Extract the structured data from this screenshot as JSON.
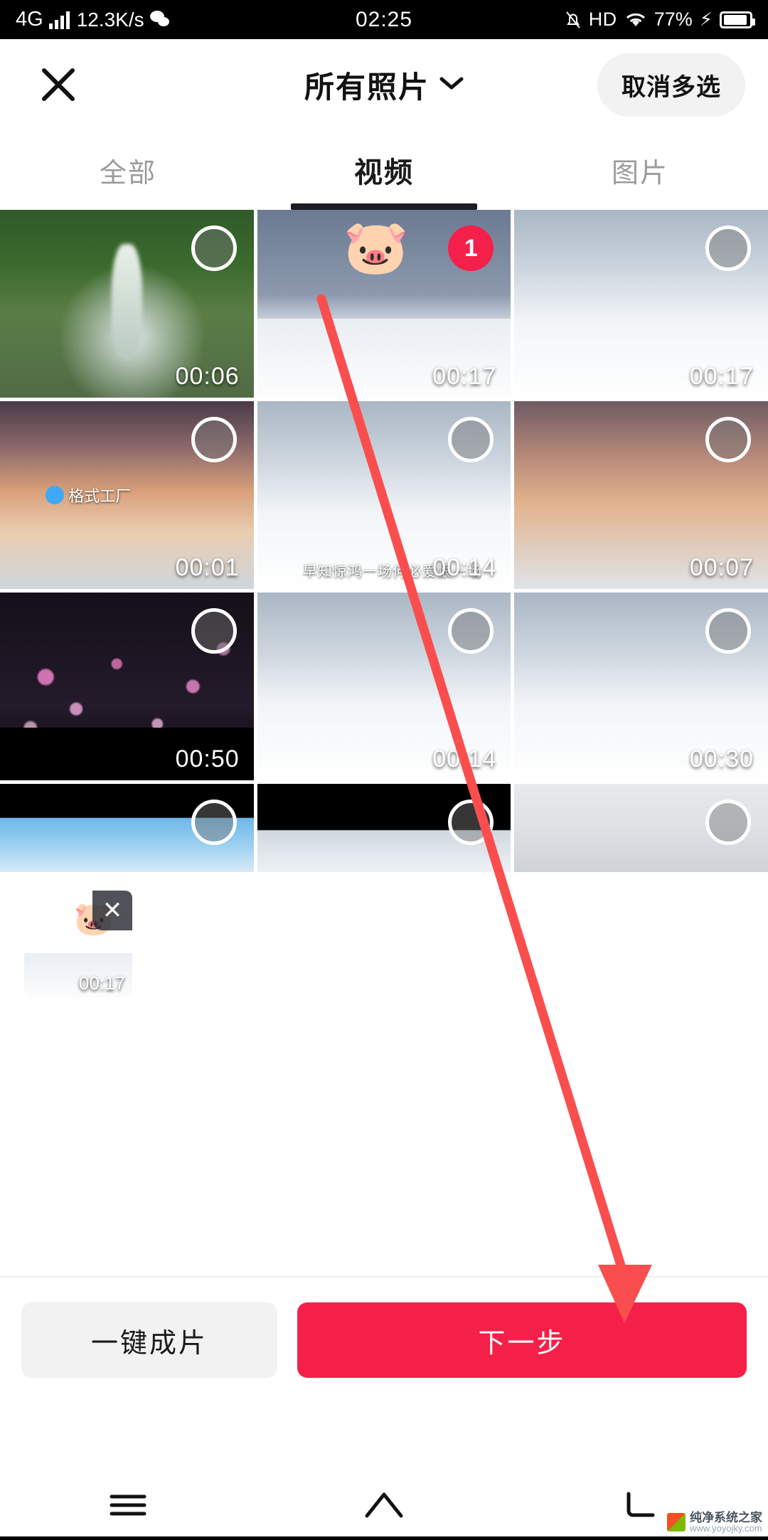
{
  "status_bar": {
    "network_type": "4G",
    "speed": "12.3K/s",
    "app_icon": "wechat-icon",
    "time": "02:25",
    "mute_icon": "bell-off-icon",
    "hd": "HD",
    "wifi_icon": "wifi-icon",
    "battery_percent": "77%",
    "charging_icon": "bolt-icon"
  },
  "header": {
    "close_icon": "close-icon",
    "title": "所有照片",
    "chevron_icon": "chevron-down-icon",
    "cancel_multi_label": "取消多选"
  },
  "tabs": [
    {
      "label": "全部",
      "active": false
    },
    {
      "label": "视频",
      "active": true
    },
    {
      "label": "图片",
      "active": false
    }
  ],
  "grid": {
    "rows": [
      [
        {
          "duration": "00:06",
          "selected": false,
          "scene": "sc-waterfall"
        },
        {
          "duration": "00:17",
          "selected": true,
          "badge": "1",
          "sticker": "🐷",
          "scene": "sc-snowdusk"
        },
        {
          "duration": "00:17",
          "selected": false,
          "scene": "sc-snowfence"
        }
      ],
      [
        {
          "duration": "00:01",
          "selected": false,
          "scene": "sc-sunset",
          "watermark": "格式工厂"
        },
        {
          "duration": "00:14",
          "selected": false,
          "scene": "sc-snowfence",
          "caption": "早知惊鸿一场何必爱恨一场"
        },
        {
          "duration": "00:07",
          "selected": false,
          "scene": "sc-sunset2"
        }
      ],
      [
        {
          "duration": "00:50",
          "selected": false,
          "scene": "sc-blossom"
        },
        {
          "duration": "00:14",
          "selected": false,
          "scene": "sc-snowfence"
        },
        {
          "duration": "00:30",
          "selected": false,
          "scene": "sc-snowfence"
        }
      ],
      [
        {
          "duration": "",
          "selected": false,
          "scene": "sc-birds"
        },
        {
          "duration": "",
          "selected": false,
          "scene": "sc-tree"
        },
        {
          "duration": "",
          "selected": false,
          "scene": "sc-fog"
        }
      ]
    ]
  },
  "selected_tray": {
    "items": [
      {
        "duration": "00:17",
        "sticker": "🐷",
        "remove_label": "✕"
      }
    ]
  },
  "action_bar": {
    "secondary_label": "一键成片",
    "primary_label": "下一步"
  },
  "nav_bar": {
    "menu_icon": "menu-icon",
    "home_icon": "home-icon",
    "back_icon": "back-icon"
  },
  "watermark": {
    "site": "纯净系统之家",
    "url": "www.yoyojky.com"
  },
  "annotation": {
    "arrow_color": "#fa4e4e"
  }
}
